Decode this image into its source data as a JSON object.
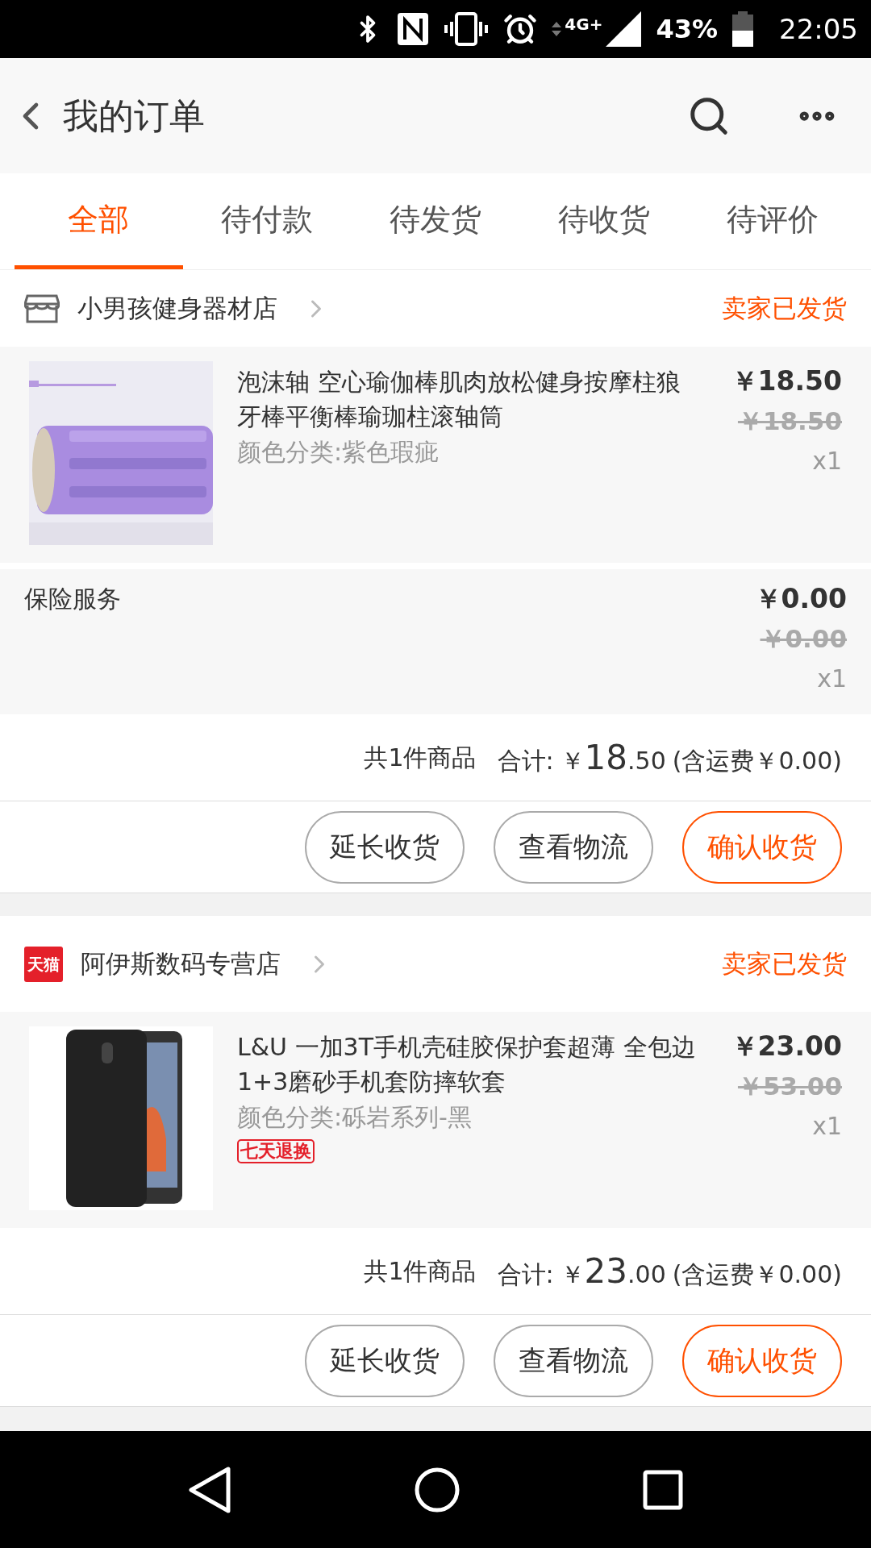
{
  "status_bar": {
    "battery": "43%",
    "time": "22:05",
    "network": "4G+"
  },
  "header": {
    "title": "我的订单"
  },
  "tabs": [
    {
      "label": "全部",
      "selected": true
    },
    {
      "label": "待付款",
      "selected": false
    },
    {
      "label": "待发货",
      "selected": false
    },
    {
      "label": "待收货",
      "selected": false
    },
    {
      "label": "待评价",
      "selected": false
    }
  ],
  "orders": [
    {
      "shop": {
        "kind": "store",
        "name": "小男孩健身器材店"
      },
      "status": "卖家已发货",
      "items": [
        {
          "kind": "product",
          "title": "泡沫轴 空心瑜伽棒肌肉放松健身按摩柱狼牙棒平衡棒瑜珈柱滚轴筒",
          "variant": "颜色分类:紫色瑕疵",
          "price": "￥18.50",
          "original_price": "￥18.50",
          "quantity": "x1"
        },
        {
          "kind": "service",
          "title": "保险服务",
          "price": "￥0.00",
          "original_price": "￥0.00",
          "quantity": "x1"
        }
      ],
      "summary": {
        "count": "共1件商品",
        "total_label": "合计:",
        "currency": "￥",
        "total_integer": "18",
        "total_decimal": ".50",
        "shipping": "(含运费￥0.00)"
      },
      "buttons": [
        {
          "label": "延长收货",
          "primary": false
        },
        {
          "label": "查看物流",
          "primary": false
        },
        {
          "label": "确认收货",
          "primary": true
        }
      ]
    },
    {
      "shop": {
        "kind": "tmall",
        "logo_text": "天猫",
        "name": "阿伊斯数码专营店"
      },
      "status": "卖家已发货",
      "items": [
        {
          "kind": "product",
          "title": "L&U 一加3T手机壳硅胶保护套超薄 全包边1+3磨砂手机套防摔软套",
          "variant": "颜色分类:砾岩系列-黑",
          "badge": "七天退换",
          "price": "￥23.00",
          "original_price": "￥53.00",
          "quantity": "x1"
        }
      ],
      "summary": {
        "count": "共1件商品",
        "total_label": "合计:",
        "currency": "￥",
        "total_integer": "23",
        "total_decimal": ".00",
        "shipping": "(含运费￥0.00)"
      },
      "buttons": [
        {
          "label": "延长收货",
          "primary": false
        },
        {
          "label": "查看物流",
          "primary": false
        },
        {
          "label": "确认收货",
          "primary": true
        }
      ]
    }
  ]
}
